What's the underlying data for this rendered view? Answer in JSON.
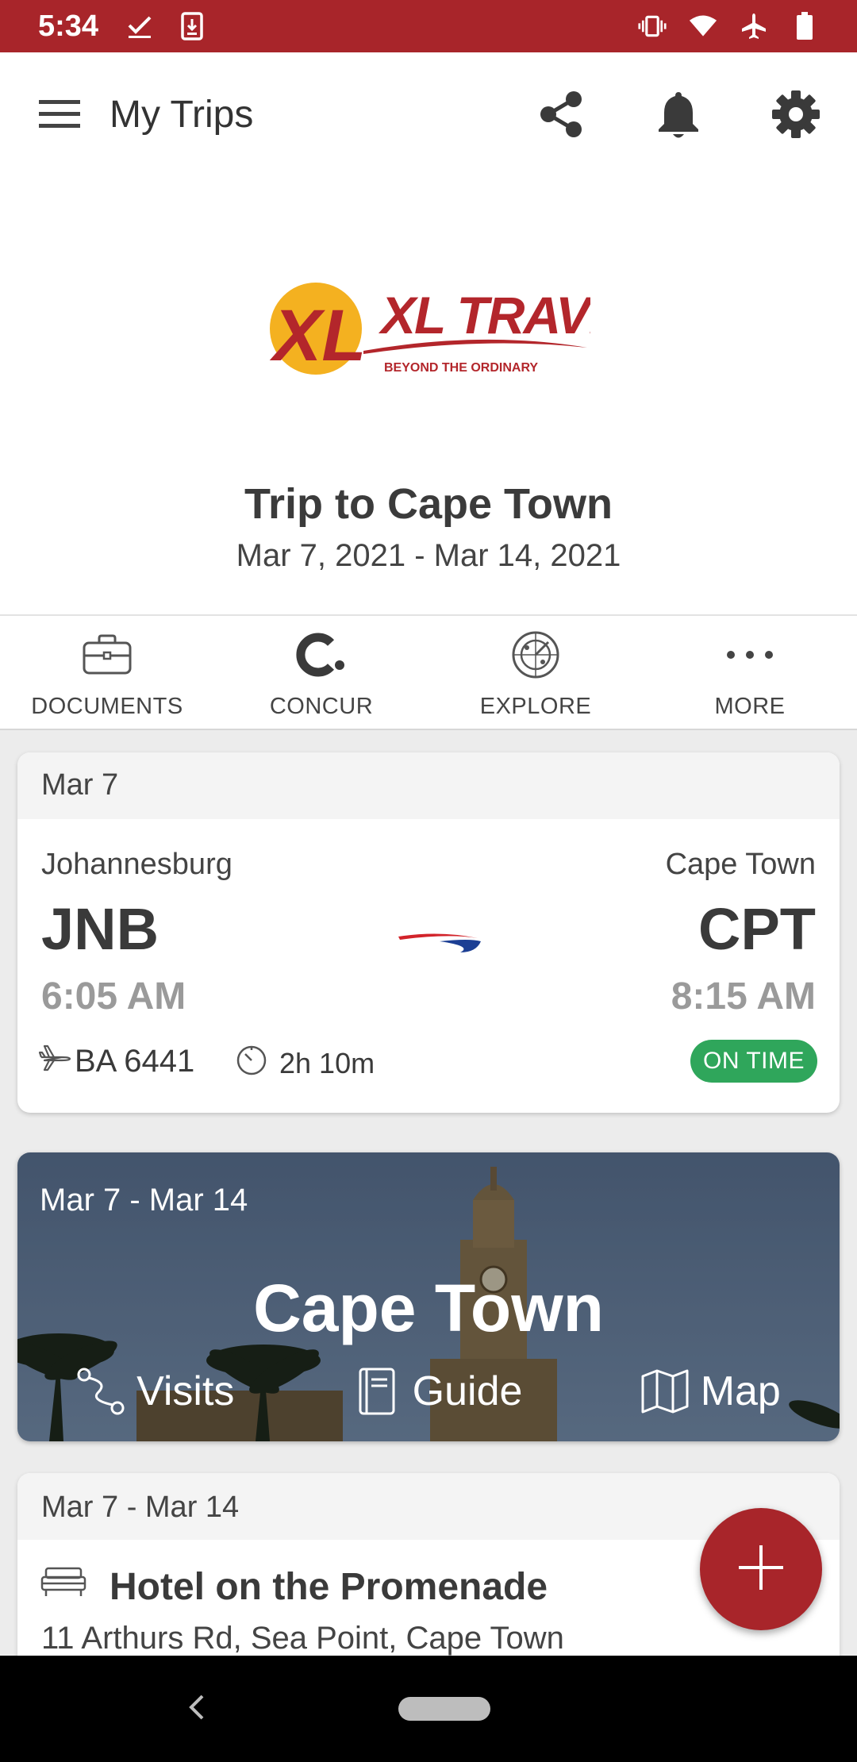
{
  "status_bar": {
    "time": "5:34",
    "icons": [
      "check-icon",
      "download-icon",
      "vibrate-icon",
      "wifi-icon",
      "airplane-mode-icon",
      "battery-icon"
    ]
  },
  "app_bar": {
    "title": "My Trips",
    "actions": [
      "share-icon",
      "bell-icon",
      "gear-icon"
    ]
  },
  "header": {
    "logo_text": "XL TRAVEL",
    "logo_tagline": "BEYOND THE ORDINARY",
    "trip_title": "Trip to Cape Town",
    "trip_dates": "Mar 7, 2021 - Mar 14, 2021"
  },
  "quick_actions": [
    {
      "label": "DOCUMENTS",
      "icon": "briefcase-icon"
    },
    {
      "label": "CONCUR",
      "icon": "concur-icon"
    },
    {
      "label": "EXPLORE",
      "icon": "radar-icon"
    },
    {
      "label": "MORE",
      "icon": "more-icon"
    }
  ],
  "flight": {
    "date": "Mar 7",
    "from_city": "Johannesburg",
    "from_code": "JNB",
    "depart_time": "6:05 AM",
    "to_city": "Cape Town",
    "to_code": "CPT",
    "arrive_time": "8:15 AM",
    "flight_number": "BA 6441",
    "duration": "2h 10m",
    "status": "ON TIME"
  },
  "destination": {
    "dates": "Mar 7 - Mar 14",
    "name": "Cape Town",
    "links": [
      {
        "label": "Visits",
        "icon": "route-icon"
      },
      {
        "label": "Guide",
        "icon": "book-icon"
      },
      {
        "label": "Map",
        "icon": "map-icon"
      }
    ]
  },
  "hotel": {
    "dates": "Mar 7 - Mar 14",
    "name": "Hotel on the Promenade",
    "address": "11 Arthurs Rd, Sea Point, Cape Town"
  },
  "colors": {
    "brand": "#a8252a",
    "on_time": "#2fa65b"
  }
}
